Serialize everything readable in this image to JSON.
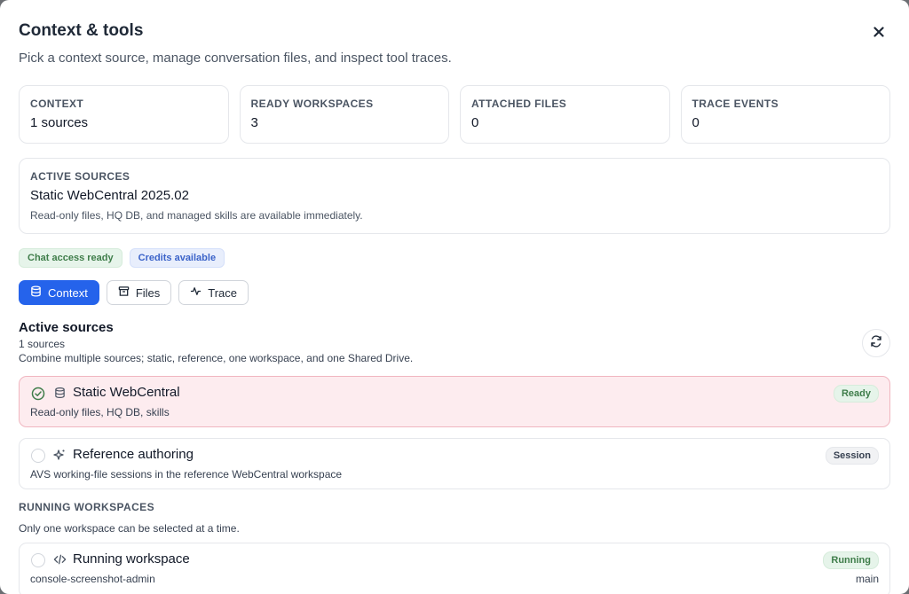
{
  "dialog": {
    "title": "Context & tools",
    "subtitle": "Pick a context source, manage conversation files, and inspect tool traces."
  },
  "stats": [
    {
      "label": "CONTEXT",
      "value": "1 sources"
    },
    {
      "label": "READY WORKSPACES",
      "value": "3"
    },
    {
      "label": "ATTACHED FILES",
      "value": "0"
    },
    {
      "label": "TRACE EVENTS",
      "value": "0"
    }
  ],
  "active_card": {
    "label": "ACTIVE SOURCES",
    "name": "Static WebCentral 2025.02",
    "description": "Read-only files, HQ DB, and managed skills are available immediately."
  },
  "badges": {
    "chat": "Chat access ready",
    "credits": "Credits available"
  },
  "tabs": [
    {
      "label": "Context",
      "icon": "database-icon"
    },
    {
      "label": "Files",
      "icon": "archive-icon"
    },
    {
      "label": "Trace",
      "icon": "activity-icon"
    }
  ],
  "section": {
    "title": "Active sources",
    "count": "1 sources",
    "hint": "Combine multiple sources; static, reference, one workspace, and one Shared Drive."
  },
  "sources": [
    {
      "name": "Static WebCentral",
      "description": "Read-only files, HQ DB, skills",
      "tag": "Ready",
      "icon": "database-icon",
      "selected": true
    },
    {
      "name": "Reference authoring",
      "description": "AVS working-file sessions in the reference WebCentral workspace",
      "tag": "Session",
      "icon": "sparkles-icon",
      "selected": false
    }
  ],
  "workspaces": {
    "label": "RUNNING WORKSPACES",
    "hint": "Only one workspace can be selected at a time.",
    "items": [
      {
        "name": "Running workspace",
        "description": "console-screenshot-admin",
        "tag": "Running",
        "branch": "main",
        "icon": "code-icon"
      }
    ]
  },
  "colors": {
    "accent": "#2563eb",
    "selected_bg": "#fdecef",
    "selected_border": "#f0b6c0",
    "ready_green": "#3f7d4a"
  }
}
